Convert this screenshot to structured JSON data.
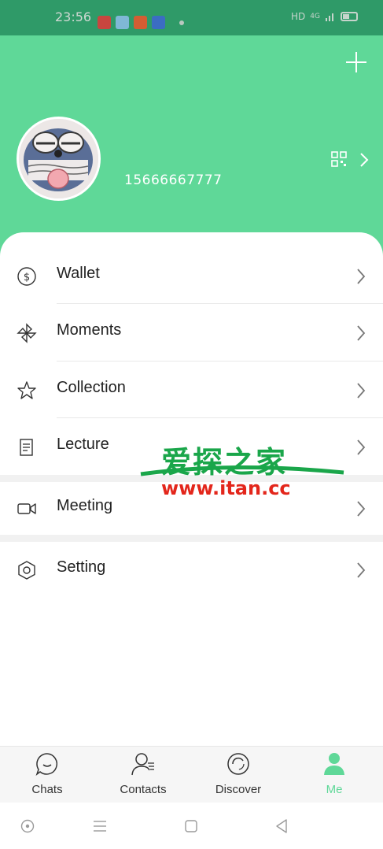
{
  "status_bar": {
    "time": "23:56",
    "network": "HD",
    "signal": "4G"
  },
  "header": {
    "add_icon": "plus-icon",
    "phone_number": "15666667777",
    "qr_icon": "qr-code-icon",
    "accent_color": "#5fd898"
  },
  "menu": [
    {
      "label": "Wallet",
      "icon": "wallet-icon"
    },
    {
      "label": "Moments",
      "icon": "moments-icon"
    },
    {
      "label": "Collection",
      "icon": "star-icon"
    },
    {
      "label": "Lecture",
      "icon": "document-icon"
    },
    {
      "label": "Meeting",
      "icon": "video-icon"
    },
    {
      "label": "Setting",
      "icon": "settings-icon"
    }
  ],
  "watermark": {
    "cn": "爱探之家",
    "url": "www.itan.cc"
  },
  "tabs": [
    {
      "label": "Chats",
      "icon": "chat-icon",
      "active": false
    },
    {
      "label": "Contacts",
      "icon": "contacts-icon",
      "active": false
    },
    {
      "label": "Discover",
      "icon": "discover-icon",
      "active": false
    },
    {
      "label": "Me",
      "icon": "me-icon",
      "active": true
    }
  ]
}
